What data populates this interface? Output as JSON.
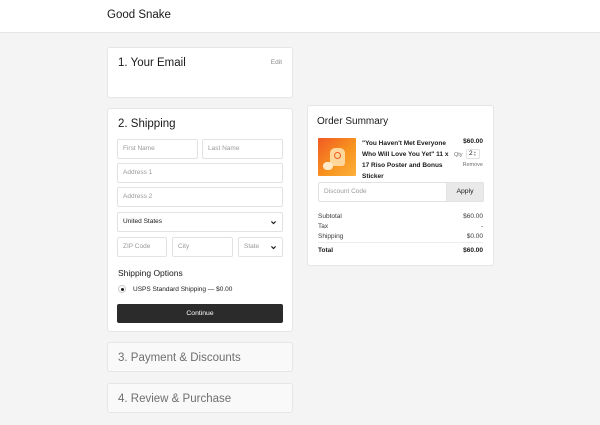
{
  "header": {
    "brand": "Good Snake"
  },
  "email_step": {
    "title": "1.  Your Email",
    "edit_label": "Edit"
  },
  "shipping_step": {
    "title": "2.  Shipping",
    "first_name_placeholder": "First Name",
    "last_name_placeholder": "Last Name",
    "address1_placeholder": "Address 1",
    "address2_placeholder": "Address 2",
    "country_value": "United States",
    "zip_placeholder": "ZIP Code",
    "city_placeholder": "City",
    "state_placeholder": "State",
    "options_title": "Shipping Options",
    "option_label": "USPS Standard Shipping — $0.00",
    "continue_label": "Continue"
  },
  "payment_step": {
    "title": "3.  Payment & Discounts"
  },
  "review_step": {
    "title": "4.  Review & Purchase"
  },
  "order_summary": {
    "title": "Order Summary",
    "item": {
      "name": "\"You Haven't Met Everyone Who Will Love You Yet\" 11 x 17 Riso Poster and Bonus Sticker",
      "price": "$60.00",
      "qty_label": "Qty",
      "qty_value": "2",
      "remove_label": "Remove"
    },
    "discount_placeholder": "Discount Code",
    "apply_label": "Apply",
    "subtotal_label": "Subtotal",
    "subtotal_value": "$60.00",
    "tax_label": "Tax",
    "tax_value": "-",
    "shipping_label": "Shipping",
    "shipping_value": "$0.00",
    "total_label": "Total",
    "total_value": "$60.00"
  },
  "colors": {
    "button_dark": "#2b2b2b",
    "thumb_orange": "#f15a24",
    "page_bg": "#f4f4f4"
  },
  "icons": [
    "chevron-down-icon",
    "radio-selected-icon",
    "stepper-arrows-icon"
  ]
}
